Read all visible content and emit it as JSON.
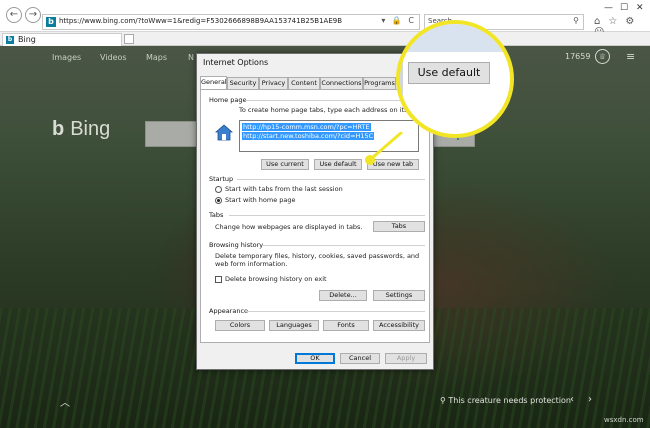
{
  "browser": {
    "url": "https://www.bing.com/?toWww=1&redig=F5302666898B9AA153741B25B1AE9B",
    "search_placeholder": "Search...",
    "tab_title": "Bing",
    "back_glyph": "←",
    "forward_glyph": "→",
    "addr_icons": "▾ 🔒 C",
    "search_glyph": "⚲",
    "win_min": "—",
    "win_max": "☐",
    "win_close": "✕",
    "tool_icons": "⌂☆⚙☺"
  },
  "page": {
    "nav": [
      "Images",
      "Videos",
      "Maps",
      "N"
    ],
    "logo_glyph": "b",
    "logo_text": "Bing",
    "search_glyph": "⚲",
    "rewards_count": "17659",
    "trophy_glyph": "♕",
    "menu_glyph": "≡",
    "up_glyph": "︿",
    "caption": "This creature needs protection",
    "arrows": "‹›",
    "watermark": "wsxdn.com"
  },
  "dialog": {
    "title": "Internet Options",
    "tabs": [
      "General",
      "Security",
      "Privacy",
      "Content",
      "Connections",
      "Programs"
    ],
    "home_page": {
      "label": "Home page",
      "instruction": "To create home page tabs, type each address on its own line.",
      "urls": [
        "http://hp15-comm.msn.com/?pc=HRTE",
        "http://start.new.toshiba.com/?cid=H15C"
      ],
      "use_current": "Use current",
      "use_default": "Use default",
      "use_new_tab": "Use new tab"
    },
    "startup": {
      "label": "Startup",
      "option_last_session": "Start with tabs from the last session",
      "option_home_page": "Start with home page",
      "selected": "home_page"
    },
    "tabs_section": {
      "label": "Tabs",
      "description": "Change how webpages are displayed in tabs.",
      "button": "Tabs"
    },
    "browsing_history": {
      "label": "Browsing history",
      "description": "Delete temporary files, history, cookies, saved passwords, and web form information.",
      "delete_on_exit": "Delete browsing history on exit",
      "delete_on_exit_checked": false,
      "delete_button": "Delete...",
      "settings_button": "Settings"
    },
    "appearance": {
      "label": "Appearance",
      "colors": "Colors",
      "languages": "Languages",
      "fonts": "Fonts",
      "accessibility": "Accessibility"
    },
    "footer": {
      "ok": "OK",
      "cancel": "Cancel",
      "apply": "Apply"
    }
  },
  "callout": {
    "button_label": "Use default",
    "highlight_color": "#f2e526"
  }
}
